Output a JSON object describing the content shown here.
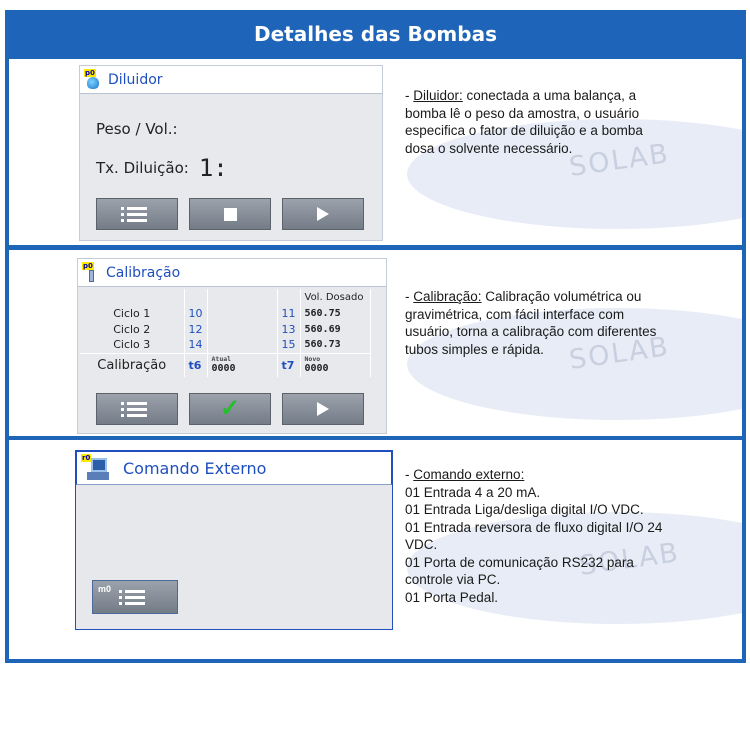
{
  "header": {
    "title": "Detalhes das Bombas"
  },
  "watermark": "SOLAB",
  "diluidor": {
    "screen_title": "Diluidor",
    "icon_badge": "p0",
    "peso_label": "Peso / Vol.:",
    "tx_label": "Tx. Diluição:",
    "tx_value": "1:",
    "desc_term": "Diluidor:",
    "desc_text": " conectada a uma balança, a bomba lê o peso da amostra, o usuário especifica o fator de diluição e a bomba dosa o solvente necessário."
  },
  "calibracao": {
    "screen_title": "Calibração",
    "icon_badge": "p0",
    "col_header": "Vol. Dosado",
    "rows": [
      {
        "label": "Ciclo 1",
        "a": "10",
        "b": "11",
        "val": "560.75"
      },
      {
        "label": "Ciclo 2",
        "a": "12",
        "b": "13",
        "val": "560.69"
      },
      {
        "label": "Ciclo 3",
        "a": "14",
        "b": "15",
        "val": "560.73"
      }
    ],
    "cal_label": "Calibração",
    "t6": "t6",
    "t7": "t7",
    "atual_label": "Atual",
    "novo_label": "Novo",
    "atual_value": "0000",
    "novo_value": "0000",
    "desc_term": "Calibração:",
    "desc_text": " Calibração volumétrica ou gravimétrica, com fácil interface com usuário, torna a calibração com diferentes tubos simples e rápida."
  },
  "comando": {
    "screen_title": "Comando Externo",
    "icon_badge": "r0",
    "btn_badge": "m0",
    "desc_term": "Comando externo:",
    "desc_lines": [
      "01 Entrada 4 a 20 mA.",
      "01 Entrada Liga/desliga digital I/O VDC.",
      "01 Entrada reversora de fluxo digital I/O 24 VDC.",
      "01 Porta de comunicação RS232 para controle via PC.",
      "01 Porta Pedal."
    ]
  },
  "icons": {
    "menu": "menu-list-icon",
    "stop": "stop-icon",
    "play": "play-icon",
    "check": "check-icon"
  },
  "colors": {
    "frame_blue": "#1e64b9",
    "title_blue": "#1f4fbf",
    "check_green": "#22c02a"
  }
}
